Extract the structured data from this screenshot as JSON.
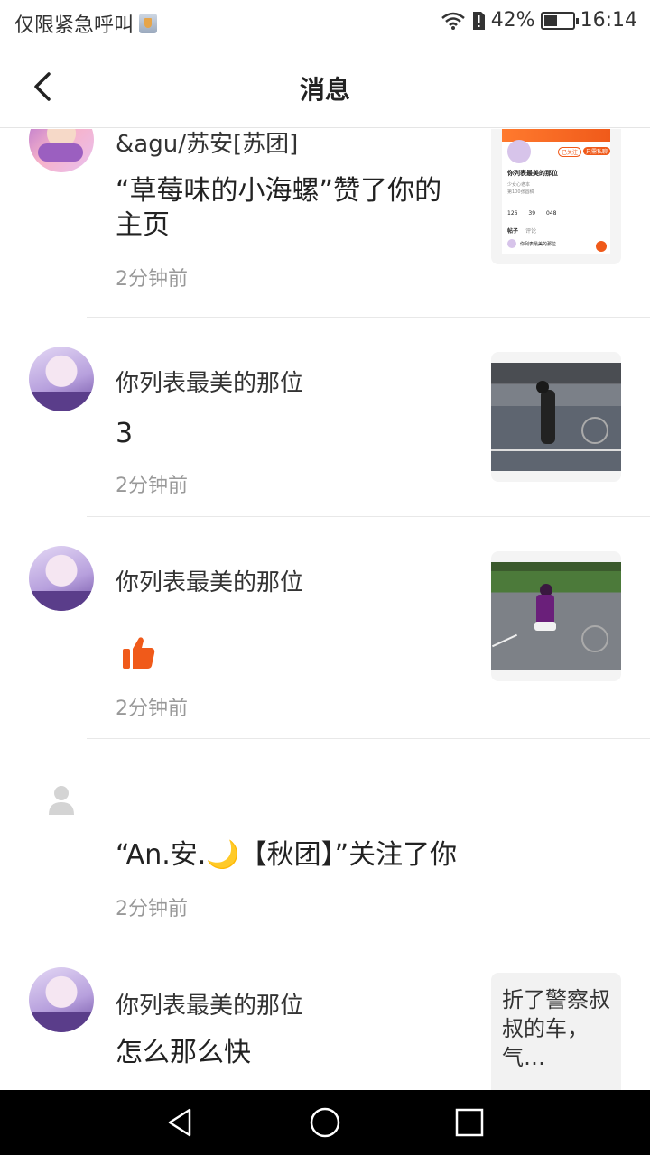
{
  "status": {
    "carrier_text": "仅限紧急呼叫",
    "battery": "42%",
    "time": "16:14"
  },
  "header": {
    "title": "消息"
  },
  "messages": [
    {
      "title": "&agu/苏安[苏团]",
      "text": "“草莓味的小海螺”赞了你的主页",
      "time": "2分钟前",
      "thumb_type": "profile",
      "thumb_profile": {
        "btn_follow": "已关注",
        "btn_message": "只需私聊",
        "name": "你列表最美的那位",
        "line1": "少女心老本",
        "line2": "第100张圆稿",
        "stat1": "126",
        "stat2": "39",
        "stat3": "048",
        "section": "帖子",
        "section2": "评论",
        "post_title": "你列表最美的那位"
      }
    },
    {
      "title": "你列表最美的那位",
      "text": "3",
      "time": "2分钟前",
      "thumb_type": "game"
    },
    {
      "title": "你列表最美的那位",
      "text": "",
      "time": "2分钟前",
      "thumb_type": "game2",
      "like_icon": "thumbs-up-icon"
    },
    {
      "title": "",
      "text": "“An.安.🌙【秋团】”关注了你",
      "time": "2分钟前",
      "avatar_type": "default"
    },
    {
      "title": "你列表最美的那位",
      "text": "怎么那么快",
      "time": "",
      "thumb_type": "text",
      "thumb_text": "折了警察叔叔的车，气…"
    }
  ],
  "colors": {
    "accent": "#f05a1a",
    "divider": "#e8e8e8",
    "time_gray": "#999999"
  }
}
